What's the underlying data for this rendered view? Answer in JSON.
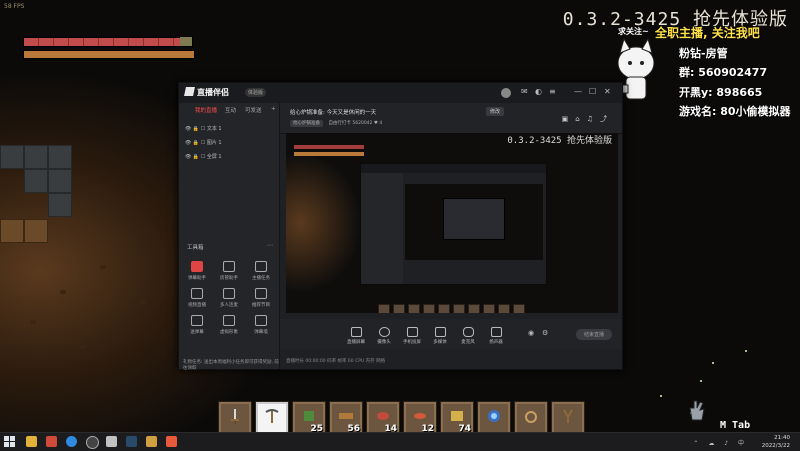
{
  "game": {
    "fps_text": "58 FPS",
    "version_text": "0.3.2-3425 抢先体验版",
    "hotbar": [
      {
        "icon": "sword-icon",
        "count": ""
      },
      {
        "icon": "pickaxe-icon",
        "count": ""
      },
      {
        "icon": "seed-icon",
        "count": "25"
      },
      {
        "icon": "wood-plank-icon",
        "count": "56"
      },
      {
        "icon": "meat-icon",
        "count": "14"
      },
      {
        "icon": "fish-icon",
        "count": "12"
      },
      {
        "icon": "scroll-icon",
        "count": "74"
      },
      {
        "icon": "orb-icon",
        "count": ""
      },
      {
        "icon": "ring-icon",
        "count": ""
      },
      {
        "icon": "slingshot-icon",
        "count": ""
      }
    ],
    "keys_hint": "M   Tab"
  },
  "stream_overlay": {
    "follow_text": "求关注~",
    "title": "全职主播, 关注我吧",
    "line1": "粉钻-房管",
    "line2": "群: 560902477",
    "line3": "开黑y: 898665",
    "line4": "游戏名: 80小偷模拟器"
  },
  "app": {
    "name": "直播伴侣",
    "version_badge": "体验版",
    "left_tabs": [
      "我的直播",
      "互动",
      "可发送"
    ],
    "layers": [
      "文本 1",
      "图片 1",
      "全屏 1"
    ],
    "tools_title": "工具箱",
    "tools": [
      {
        "label": "弹幕助手",
        "icon": "danmu-icon",
        "highlight": true
      },
      {
        "label": "房管助手",
        "icon": "manager-icon",
        "highlight": false
      },
      {
        "label": "主播任务",
        "icon": "task-icon",
        "highlight": false
      },
      {
        "label": "视频直播",
        "icon": "video-icon",
        "highlight": false
      },
      {
        "label": "多人连麦",
        "icon": "multi-icon",
        "highlight": false
      },
      {
        "label": "推荐节目",
        "icon": "recommend-icon",
        "highlight": false
      },
      {
        "label": "送弹幕",
        "icon": "gift-icon",
        "highlight": false
      },
      {
        "label": "虚拟形象",
        "icon": "avatar-icon",
        "highlight": false
      },
      {
        "label": "弹幕墙",
        "icon": "wall-icon",
        "highlight": false
      }
    ],
    "status_left": "礼物任务: 送出本周福利小任务即可获得奖励, 前往领取",
    "stream_title": "给心炉锅准备: 今天又是休闲的一天",
    "edit_button": "修改",
    "sub_chip": "他心炉锅准备",
    "sub_text": "自由行打卡     5620042",
    "likes": "4",
    "bottom_controls": [
      {
        "label": "直播屏幕",
        "icon": "screen-icon"
      },
      {
        "label": "摄像头",
        "icon": "camera-icon"
      },
      {
        "label": "手机投屏",
        "icon": "phone-icon"
      },
      {
        "label": "多媒体",
        "icon": "media-icon"
      },
      {
        "label": "麦克风",
        "icon": "mic-icon"
      },
      {
        "label": "扬声器",
        "icon": "speaker-icon"
      }
    ],
    "live_button": "结束直播",
    "status_bar": "直播时长      00:00:00      码率      帧率 60      CPU      内存      网络"
  },
  "taskbar": {
    "time": "21:40",
    "date": "2022/3/22"
  }
}
